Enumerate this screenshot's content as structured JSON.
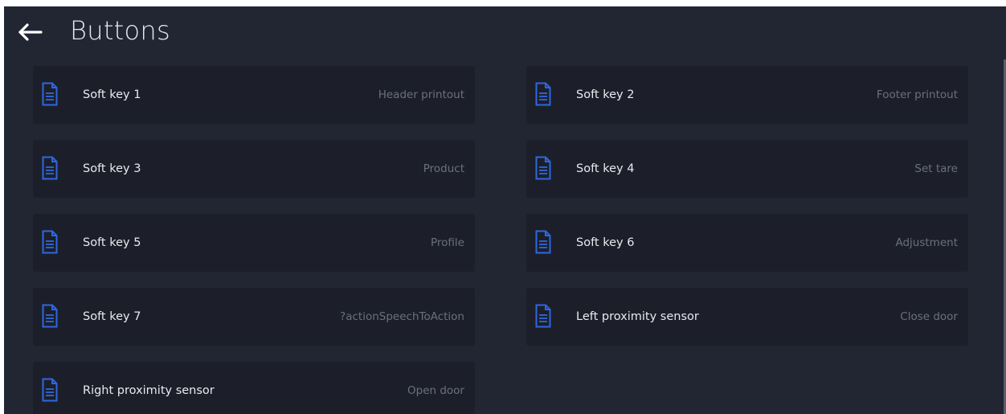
{
  "header": {
    "back_icon": "arrow-left-icon",
    "title": "Buttons"
  },
  "colors": {
    "background": "#222633",
    "tile": "#1c1f2a",
    "icon_accent": "#2e67e0",
    "label": "#e8eaef",
    "value": "#6b707d"
  },
  "items": [
    {
      "label": "Soft key 1",
      "value": "Header printout",
      "icon": "document-icon"
    },
    {
      "label": "Soft key 2",
      "value": "Footer printout",
      "icon": "document-icon"
    },
    {
      "label": "Soft key 3",
      "value": "Product",
      "icon": "document-icon"
    },
    {
      "label": "Soft key 4",
      "value": "Set tare",
      "icon": "document-icon"
    },
    {
      "label": "Soft key 5",
      "value": "Profile",
      "icon": "document-icon"
    },
    {
      "label": "Soft key 6",
      "value": "Adjustment",
      "icon": "document-icon"
    },
    {
      "label": "Soft key 7",
      "value": "?actionSpeechToAction",
      "icon": "document-icon"
    },
    {
      "label": "Left proximity sensor",
      "value": "Close door",
      "icon": "document-icon"
    },
    {
      "label": "Right proximity sensor",
      "value": "Open door",
      "icon": "document-icon"
    }
  ]
}
